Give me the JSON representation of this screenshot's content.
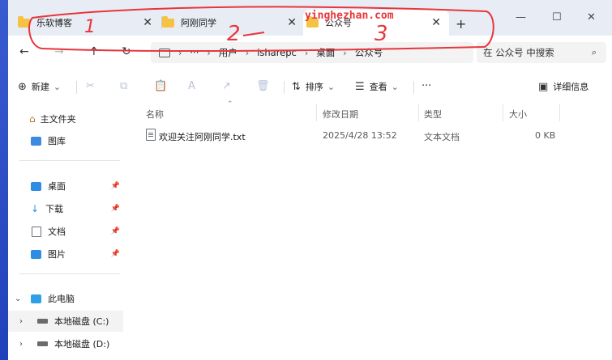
{
  "watermark": "yinghezhan.com",
  "tabs": [
    {
      "label": "乐软博客",
      "close": "✕"
    },
    {
      "label": "阿刚同学",
      "close": "✕"
    },
    {
      "label": "公众号",
      "close": "✕"
    }
  ],
  "new_tab": "+",
  "window_controls": {
    "minimize": "—",
    "maximize": "☐",
    "close": "✕"
  },
  "nav": {
    "back": "←",
    "forward": "→",
    "up": "↑",
    "refresh": "↻"
  },
  "breadcrumb": {
    "chevron": "›",
    "ellipsis": "···",
    "items": [
      "用户",
      "isharepc",
      "桌面",
      "公众号"
    ]
  },
  "search": {
    "placeholder": "在 公众号 中搜索",
    "icon": "⌕"
  },
  "toolbar": {
    "new_label": "新建",
    "new_icon": "⊕",
    "dropdown": "⌄",
    "cut_icon": "✂",
    "copy_icon": "⧉",
    "paste_icon": "📋",
    "rename_icon": "A",
    "share_icon": "↗",
    "delete_icon": "🗑",
    "sort_label": "排序",
    "sort_icon": "⇅",
    "view_label": "查看",
    "view_icon": "☰",
    "more_icon": "···",
    "details_label": "详细信息",
    "details_icon": "▣"
  },
  "sidebar": {
    "pin": "📌",
    "expand": "›",
    "expanded": "⌄",
    "items": [
      {
        "label": "主文件夹"
      },
      {
        "label": "图库"
      },
      {
        "label": "桌面"
      },
      {
        "label": "下载"
      },
      {
        "label": "文档"
      },
      {
        "label": "图片"
      },
      {
        "label": "此电脑"
      },
      {
        "label": "本地磁盘 (C:)"
      },
      {
        "label": "本地磁盘 (D:)"
      }
    ]
  },
  "columns": {
    "name": "名称",
    "date": "修改日期",
    "type": "类型",
    "size": "大小",
    "sort_indicator": "⌃"
  },
  "files": [
    {
      "name": "欢迎关注阿刚同学.txt",
      "date": "2025/4/28 13:52",
      "type": "文本文档",
      "size": "0 KB"
    }
  ],
  "annotations": [
    "1",
    "2",
    "3"
  ],
  "colors": {
    "annotation": "#e8353b",
    "folder": "#f5c242",
    "accent": "#2f8de4"
  }
}
